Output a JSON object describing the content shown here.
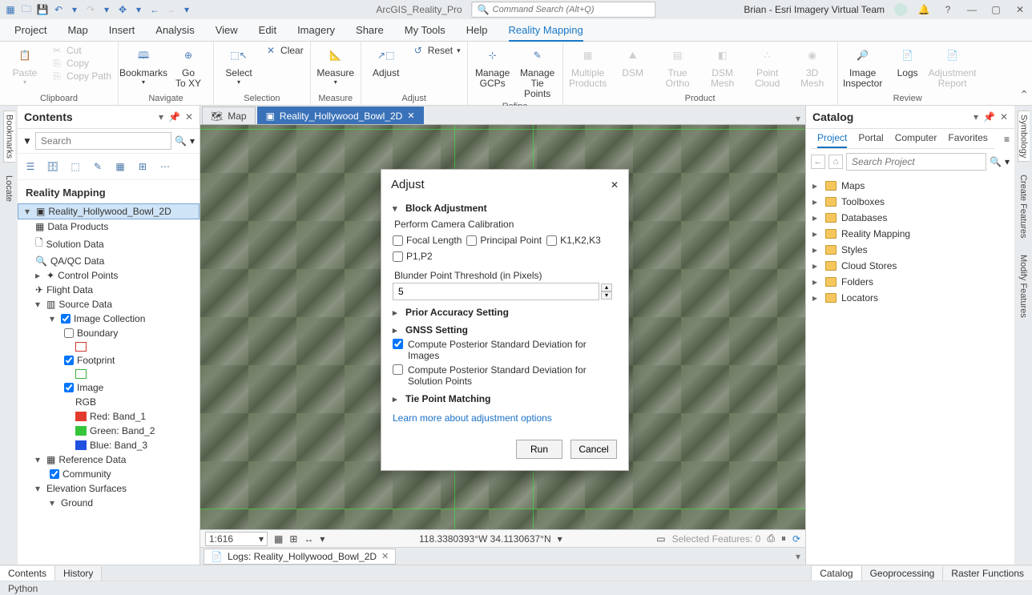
{
  "titlebar": {
    "app_title": "ArcGIS_Reality_Pro",
    "command_search_placeholder": "Command Search (Alt+Q)",
    "user_label": "Brian  -  Esri Imagery Virtual Team"
  },
  "menu": {
    "items": [
      "Project",
      "Map",
      "Insert",
      "Analysis",
      "View",
      "Edit",
      "Imagery",
      "Share",
      "My Tools",
      "Help",
      "Reality Mapping"
    ],
    "active_index": 10
  },
  "ribbon": {
    "clipboard": {
      "paste": "Paste",
      "cut": "Cut",
      "copy": "Copy",
      "copy_path": "Copy Path",
      "label": "Clipboard"
    },
    "navigate": {
      "bookmarks": "Bookmarks",
      "go_to_xy": "Go\nTo XY",
      "label": "Navigate"
    },
    "selection": {
      "select": "Select",
      "clear": "Clear",
      "label": "Selection"
    },
    "measure": {
      "measure": "Measure",
      "label": "Measure"
    },
    "adjust": {
      "adjust": "Adjust",
      "reset": "Reset",
      "label": "Adjust"
    },
    "refine": {
      "manage_gcps": "Manage\nGCPs",
      "manage_tie": "Manage\nTie Points",
      "label": "Refine"
    },
    "product": {
      "multiple": "Multiple\nProducts",
      "dsm": "DSM",
      "true_ortho": "True\nOrtho",
      "dsm_mesh": "DSM\nMesh",
      "point_cloud": "Point\nCloud",
      "td_mesh": "3D\nMesh",
      "label": "Product"
    },
    "review": {
      "image_inspector": "Image\nInspector",
      "logs": "Logs",
      "adj_report": "Adjustment\nReport",
      "label": "Review"
    }
  },
  "contents_panel": {
    "title": "Contents",
    "search_placeholder": "Search",
    "section_title": "Reality Mapping",
    "project_node": "Reality_Hollywood_Bowl_2D",
    "nodes": {
      "data_products": "Data Products",
      "solution_data": "Solution Data",
      "qaqc": "QA/QC Data",
      "control_points": "Control Points",
      "flight_data": "Flight Data",
      "source_data": "Source Data",
      "image_collection": "Image Collection",
      "boundary": "Boundary",
      "footprint": "Footprint",
      "image": "Image",
      "rgb": "RGB",
      "red": "Red:   Band_1",
      "green": "Green: Band_2",
      "blue": "Blue:   Band_3",
      "reference_data": "Reference Data",
      "community": "Community",
      "elev_surfaces": "Elevation Surfaces",
      "ground": "Ground"
    },
    "bottom_tabs": [
      "Contents",
      "History"
    ]
  },
  "left_vtabs": [
    "Bookmarks",
    "Locate"
  ],
  "right_vtabs": [
    "Symbology",
    "Create Features",
    "Modify Features"
  ],
  "doc_tabs": {
    "items": [
      {
        "label": "Map",
        "active": false
      },
      {
        "label": "Reality_Hollywood_Bowl_2D",
        "active": true
      }
    ]
  },
  "map_status": {
    "scale": "1:616",
    "coords": "118.3380393°W 34.1130637°N",
    "selected_features": "Selected Features: 0"
  },
  "logs": {
    "tab_label": "Logs: Reality_Hollywood_Bowl_2D"
  },
  "catalog": {
    "title": "Catalog",
    "tabs": [
      "Project",
      "Portal",
      "Computer",
      "Favorites"
    ],
    "active_tab": 0,
    "search_placeholder": "Search Project",
    "items": [
      "Maps",
      "Toolboxes",
      "Databases",
      "Reality Mapping",
      "Styles",
      "Cloud Stores",
      "Folders",
      "Locators"
    ],
    "bottom_tabs": [
      "Catalog",
      "Geoprocessing",
      "Raster Functions"
    ]
  },
  "dialog": {
    "title": "Adjust",
    "block_adjustment": "Block Adjustment",
    "perform_cal": "Perform Camera Calibration",
    "focal": "Focal Length",
    "principal": "Principal Point",
    "k123": "K1,K2,K3",
    "p12": "P1,P2",
    "blunder_label": "Blunder Point Threshold (in Pixels)",
    "blunder_value": "5",
    "prior": "Prior Accuracy Setting",
    "gnss": "GNSS Setting",
    "post_images": "Compute Posterior Standard Deviation for Images",
    "post_solution": "Compute Posterior Standard Deviation for Solution Points",
    "tie_point": "Tie Point Matching",
    "learn_link": "Learn more about adjustment options",
    "run": "Run",
    "cancel": "Cancel"
  },
  "python_label": "Python"
}
